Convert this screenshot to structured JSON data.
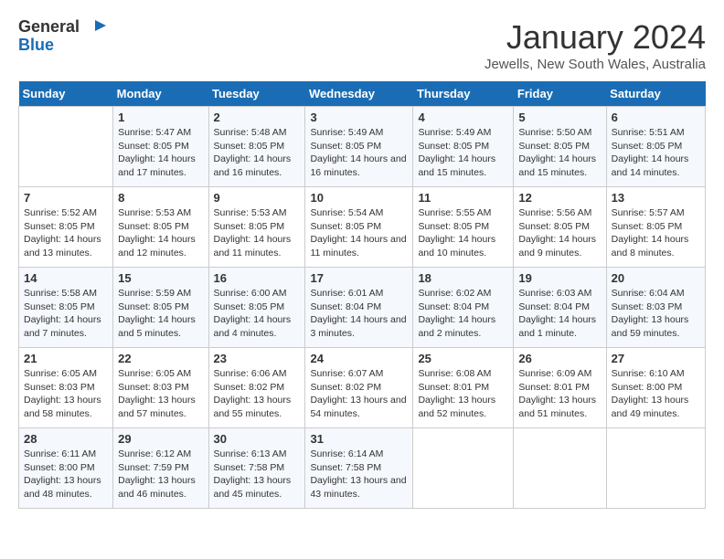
{
  "logo": {
    "text_general": "General",
    "text_blue": "Blue"
  },
  "header": {
    "month_title": "January 2024",
    "location": "Jewells, New South Wales, Australia"
  },
  "weekdays": [
    "Sunday",
    "Monday",
    "Tuesday",
    "Wednesday",
    "Thursday",
    "Friday",
    "Saturday"
  ],
  "weeks": [
    [
      {
        "day": "",
        "sunrise": "",
        "sunset": "",
        "daylight": ""
      },
      {
        "day": "1",
        "sunrise": "Sunrise: 5:47 AM",
        "sunset": "Sunset: 8:05 PM",
        "daylight": "Daylight: 14 hours and 17 minutes."
      },
      {
        "day": "2",
        "sunrise": "Sunrise: 5:48 AM",
        "sunset": "Sunset: 8:05 PM",
        "daylight": "Daylight: 14 hours and 16 minutes."
      },
      {
        "day": "3",
        "sunrise": "Sunrise: 5:49 AM",
        "sunset": "Sunset: 8:05 PM",
        "daylight": "Daylight: 14 hours and 16 minutes."
      },
      {
        "day": "4",
        "sunrise": "Sunrise: 5:49 AM",
        "sunset": "Sunset: 8:05 PM",
        "daylight": "Daylight: 14 hours and 15 minutes."
      },
      {
        "day": "5",
        "sunrise": "Sunrise: 5:50 AM",
        "sunset": "Sunset: 8:05 PM",
        "daylight": "Daylight: 14 hours and 15 minutes."
      },
      {
        "day": "6",
        "sunrise": "Sunrise: 5:51 AM",
        "sunset": "Sunset: 8:05 PM",
        "daylight": "Daylight: 14 hours and 14 minutes."
      }
    ],
    [
      {
        "day": "7",
        "sunrise": "Sunrise: 5:52 AM",
        "sunset": "Sunset: 8:05 PM",
        "daylight": "Daylight: 14 hours and 13 minutes."
      },
      {
        "day": "8",
        "sunrise": "Sunrise: 5:53 AM",
        "sunset": "Sunset: 8:05 PM",
        "daylight": "Daylight: 14 hours and 12 minutes."
      },
      {
        "day": "9",
        "sunrise": "Sunrise: 5:53 AM",
        "sunset": "Sunset: 8:05 PM",
        "daylight": "Daylight: 14 hours and 11 minutes."
      },
      {
        "day": "10",
        "sunrise": "Sunrise: 5:54 AM",
        "sunset": "Sunset: 8:05 PM",
        "daylight": "Daylight: 14 hours and 11 minutes."
      },
      {
        "day": "11",
        "sunrise": "Sunrise: 5:55 AM",
        "sunset": "Sunset: 8:05 PM",
        "daylight": "Daylight: 14 hours and 10 minutes."
      },
      {
        "day": "12",
        "sunrise": "Sunrise: 5:56 AM",
        "sunset": "Sunset: 8:05 PM",
        "daylight": "Daylight: 14 hours and 9 minutes."
      },
      {
        "day": "13",
        "sunrise": "Sunrise: 5:57 AM",
        "sunset": "Sunset: 8:05 PM",
        "daylight": "Daylight: 14 hours and 8 minutes."
      }
    ],
    [
      {
        "day": "14",
        "sunrise": "Sunrise: 5:58 AM",
        "sunset": "Sunset: 8:05 PM",
        "daylight": "Daylight: 14 hours and 7 minutes."
      },
      {
        "day": "15",
        "sunrise": "Sunrise: 5:59 AM",
        "sunset": "Sunset: 8:05 PM",
        "daylight": "Daylight: 14 hours and 5 minutes."
      },
      {
        "day": "16",
        "sunrise": "Sunrise: 6:00 AM",
        "sunset": "Sunset: 8:05 PM",
        "daylight": "Daylight: 14 hours and 4 minutes."
      },
      {
        "day": "17",
        "sunrise": "Sunrise: 6:01 AM",
        "sunset": "Sunset: 8:04 PM",
        "daylight": "Daylight: 14 hours and 3 minutes."
      },
      {
        "day": "18",
        "sunrise": "Sunrise: 6:02 AM",
        "sunset": "Sunset: 8:04 PM",
        "daylight": "Daylight: 14 hours and 2 minutes."
      },
      {
        "day": "19",
        "sunrise": "Sunrise: 6:03 AM",
        "sunset": "Sunset: 8:04 PM",
        "daylight": "Daylight: 14 hours and 1 minute."
      },
      {
        "day": "20",
        "sunrise": "Sunrise: 6:04 AM",
        "sunset": "Sunset: 8:03 PM",
        "daylight": "Daylight: 13 hours and 59 minutes."
      }
    ],
    [
      {
        "day": "21",
        "sunrise": "Sunrise: 6:05 AM",
        "sunset": "Sunset: 8:03 PM",
        "daylight": "Daylight: 13 hours and 58 minutes."
      },
      {
        "day": "22",
        "sunrise": "Sunrise: 6:05 AM",
        "sunset": "Sunset: 8:03 PM",
        "daylight": "Daylight: 13 hours and 57 minutes."
      },
      {
        "day": "23",
        "sunrise": "Sunrise: 6:06 AM",
        "sunset": "Sunset: 8:02 PM",
        "daylight": "Daylight: 13 hours and 55 minutes."
      },
      {
        "day": "24",
        "sunrise": "Sunrise: 6:07 AM",
        "sunset": "Sunset: 8:02 PM",
        "daylight": "Daylight: 13 hours and 54 minutes."
      },
      {
        "day": "25",
        "sunrise": "Sunrise: 6:08 AM",
        "sunset": "Sunset: 8:01 PM",
        "daylight": "Daylight: 13 hours and 52 minutes."
      },
      {
        "day": "26",
        "sunrise": "Sunrise: 6:09 AM",
        "sunset": "Sunset: 8:01 PM",
        "daylight": "Daylight: 13 hours and 51 minutes."
      },
      {
        "day": "27",
        "sunrise": "Sunrise: 6:10 AM",
        "sunset": "Sunset: 8:00 PM",
        "daylight": "Daylight: 13 hours and 49 minutes."
      }
    ],
    [
      {
        "day": "28",
        "sunrise": "Sunrise: 6:11 AM",
        "sunset": "Sunset: 8:00 PM",
        "daylight": "Daylight: 13 hours and 48 minutes."
      },
      {
        "day": "29",
        "sunrise": "Sunrise: 6:12 AM",
        "sunset": "Sunset: 7:59 PM",
        "daylight": "Daylight: 13 hours and 46 minutes."
      },
      {
        "day": "30",
        "sunrise": "Sunrise: 6:13 AM",
        "sunset": "Sunset: 7:58 PM",
        "daylight": "Daylight: 13 hours and 45 minutes."
      },
      {
        "day": "31",
        "sunrise": "Sunrise: 6:14 AM",
        "sunset": "Sunset: 7:58 PM",
        "daylight": "Daylight: 13 hours and 43 minutes."
      },
      {
        "day": "",
        "sunrise": "",
        "sunset": "",
        "daylight": ""
      },
      {
        "day": "",
        "sunrise": "",
        "sunset": "",
        "daylight": ""
      },
      {
        "day": "",
        "sunrise": "",
        "sunset": "",
        "daylight": ""
      }
    ]
  ]
}
